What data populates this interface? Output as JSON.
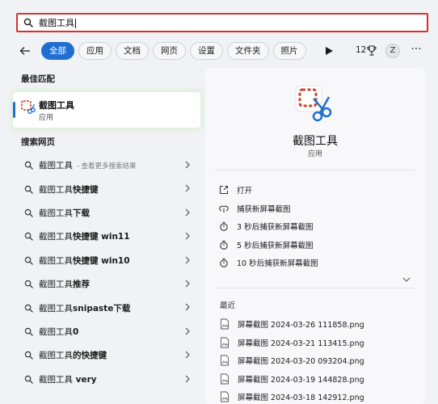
{
  "search": {
    "query": "截图工具"
  },
  "filters": {
    "tabs": [
      "全部",
      "应用",
      "文档",
      "网页",
      "设置",
      "文件夹",
      "照片"
    ],
    "active_index": 0,
    "points": "12",
    "avatar_initial": "Z",
    "more_label": "···"
  },
  "best_match": {
    "section_title": "最佳匹配",
    "title": "截图工具",
    "subtitle": "应用"
  },
  "web": {
    "section_title": "搜索网页",
    "items": [
      {
        "prefix": "截图工具",
        "bold": "",
        "hint": " - 查看更多搜索结果"
      },
      {
        "prefix": "截图工具",
        "bold": "快捷键",
        "hint": ""
      },
      {
        "prefix": "截图工具",
        "bold": "下载",
        "hint": ""
      },
      {
        "prefix": "截图工具",
        "bold": "快捷键 win11",
        "hint": ""
      },
      {
        "prefix": "截图工具",
        "bold": "快捷键 win10",
        "hint": ""
      },
      {
        "prefix": "截图工具",
        "bold": "推荐",
        "hint": ""
      },
      {
        "prefix": "截图工具",
        "bold": "snipaste下载",
        "hint": ""
      },
      {
        "prefix": "截图工具",
        "bold": "0",
        "hint": ""
      },
      {
        "prefix": "截图工具",
        "bold": "的快捷键",
        "hint": ""
      },
      {
        "prefix": "截图工具",
        "bold": " very",
        "hint": ""
      }
    ]
  },
  "detail": {
    "app_name": "截图工具",
    "app_type": "应用",
    "actions": [
      {
        "label": "打开",
        "icon": "open-icon"
      },
      {
        "label": "捕获新屏幕截图",
        "icon": "capture-icon"
      },
      {
        "label": "3 秒后捕获新屏幕截图",
        "icon": "timer-icon"
      },
      {
        "label": "5 秒后捕获新屏幕截图",
        "icon": "timer-icon"
      },
      {
        "label": "10 秒后捕获新屏幕截图",
        "icon": "timer-icon"
      }
    ],
    "recent_title": "最近",
    "recent": [
      "屏幕截图 2024-03-26 111858.png",
      "屏幕截图 2024-03-21 113415.png",
      "屏幕截图 2024-03-20 093204.png",
      "屏幕截图 2024-03-19 144828.png",
      "屏幕截图 2024-03-18 142912.png"
    ]
  },
  "colors": {
    "accent": "#1f6fd1",
    "highlight_border": "#d9302b",
    "snip_red": "#c8472f"
  }
}
